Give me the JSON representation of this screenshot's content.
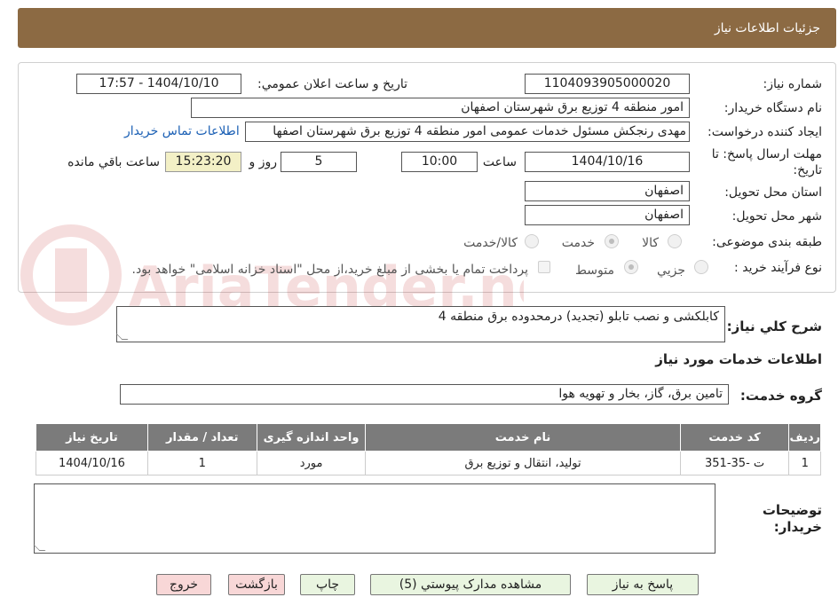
{
  "header": {
    "title": "جزئیات اطلاعات نیاز"
  },
  "form": {
    "need_number_label": "شماره نیاز:",
    "need_number": "1104093905000020",
    "announce_label": "تاریخ و ساعت اعلان عمومي:",
    "announce_value": "1404/10/10 - 17:57",
    "buyer_label": "نام دستگاه خريدار:",
    "buyer_value": "امور منطقه 4 توزیع برق شهرستان اصفهان",
    "creator_label": "ايجاد كننده درخواست:",
    "creator_value": "مهدی رنجکش مسئول خدمات عمومی امور منطقه 4 توزیع برق شهرستان اصفها",
    "contact_link": "اطلاعات تماس خريدار",
    "deadline_label_1": "مهلت ارسال پاسخ: تا",
    "deadline_label_2": "تاریخ:",
    "deadline_date": "1404/10/16",
    "time_label": "ساعت",
    "deadline_time": "10:00",
    "days_value": "5",
    "days_label": "روز و",
    "remaining_time": "15:23:20",
    "remaining_label": "ساعت باقي مانده",
    "province_label": "استان محل تحويل:",
    "province_value": "اصفهان",
    "city_label": "شهر محل تحويل:",
    "city_value": "اصفهان",
    "category_label": "طبقه بندی موضوعی:",
    "category_options": [
      "كالا",
      "خدمت",
      "كالا/خدمت"
    ],
    "category_selected": "خدمت",
    "process_label": "نوع فرآيند خريد :",
    "process_options": [
      "جزيي",
      "متوسط"
    ],
    "process_selected": "متوسط",
    "payment_note": "پرداخت تمام يا بخشی از مبلغ خريد،از محل \"اسناد خزانه اسلامی\" خواهد بود."
  },
  "description": {
    "label": "شرح كلي نياز:",
    "value": "کابلکشی و نصب تابلو (تجدید) درمحدوده برق منطقه 4"
  },
  "services": {
    "section_title": "اطلاعات خدمات مورد نياز",
    "group_label": "گروه خدمت:",
    "group_value": "تامين برق، گاز، بخار و تهويه هوا",
    "columns": [
      "رديف",
      "كد خدمت",
      "نام خدمت",
      "واحد اندازه گيری",
      "تعداد / مقدار",
      "تاريخ نياز"
    ],
    "rows": [
      {
        "row": "1",
        "code": "ت -35-351",
        "name": "تولید، انتقال و توزیع برق",
        "unit": "مورد",
        "qty": "1",
        "date": "1404/10/16"
      }
    ]
  },
  "buyer_notes": {
    "label_1": "توضيحات",
    "label_2": "خريدار:",
    "value": ""
  },
  "buttons": {
    "reply": "پاسخ به نياز",
    "docs": "مشاهده مدارک پيوستي (5)",
    "print": "چاپ",
    "back": "بازگشت",
    "exit": "خروج"
  },
  "watermark": {
    "text": "AriaTender.neT"
  },
  "colors": {
    "header": "#8c6a43",
    "table_header": "#7b7b7b",
    "button_green": "#e9f5e0",
    "button_red": "#f8d7d7"
  }
}
